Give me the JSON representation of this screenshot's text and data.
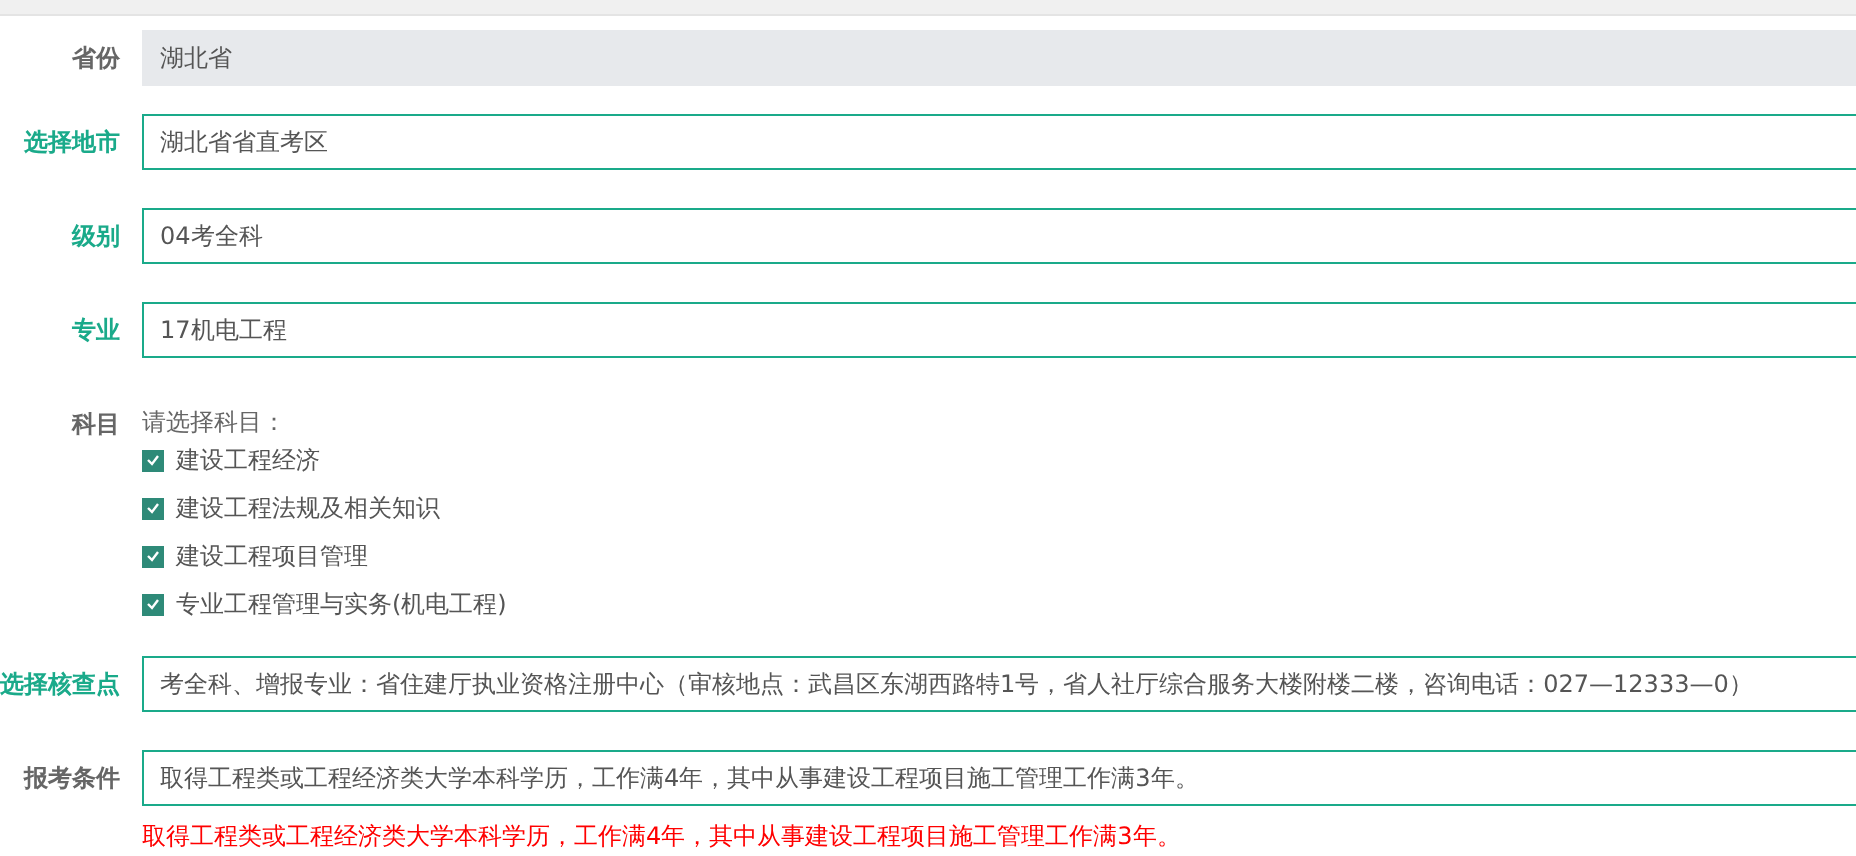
{
  "fields": [
    {
      "label": "省份",
      "highlighted": false,
      "kind": "input",
      "value": "湖北省",
      "disabled": true
    },
    {
      "label": "选择地市",
      "highlighted": true,
      "kind": "input",
      "value": "湖北省省直考区",
      "disabled": false
    },
    {
      "label": "级别",
      "highlighted": true,
      "kind": "input",
      "value": "04考全科",
      "disabled": false
    },
    {
      "label": "专业",
      "highlighted": true,
      "kind": "input",
      "value": "17机电工程",
      "disabled": false
    },
    {
      "label": "科目",
      "highlighted": false,
      "kind": "checklist",
      "prompt": "请选择科目：",
      "options": [
        {
          "label": "建设工程经济",
          "checked": true
        },
        {
          "label": "建设工程法规及相关知识",
          "checked": true
        },
        {
          "label": "建设工程项目管理",
          "checked": true
        },
        {
          "label": "专业工程管理与实务(机电工程)",
          "checked": true
        }
      ]
    },
    {
      "label": "选择核查点",
      "highlighted": true,
      "kind": "input",
      "value": "考全科、增报专业：省住建厅执业资格注册中心（审核地点：武昌区东湖西路特1号，省人社厅综合服务大楼附楼二楼，咨询电话：027—12333—0）",
      "disabled": false
    },
    {
      "label": "报考条件",
      "highlighted": false,
      "kind": "input",
      "value": "取得工程类或工程经济类大学本科学历，工作满4年，其中从事建设工程项目施工管理工作满3年。",
      "disabled": false,
      "note": "取得工程类或工程经济类大学本科学历，工作满4年，其中从事建设工程项目施工管理工作满3年。"
    }
  ]
}
